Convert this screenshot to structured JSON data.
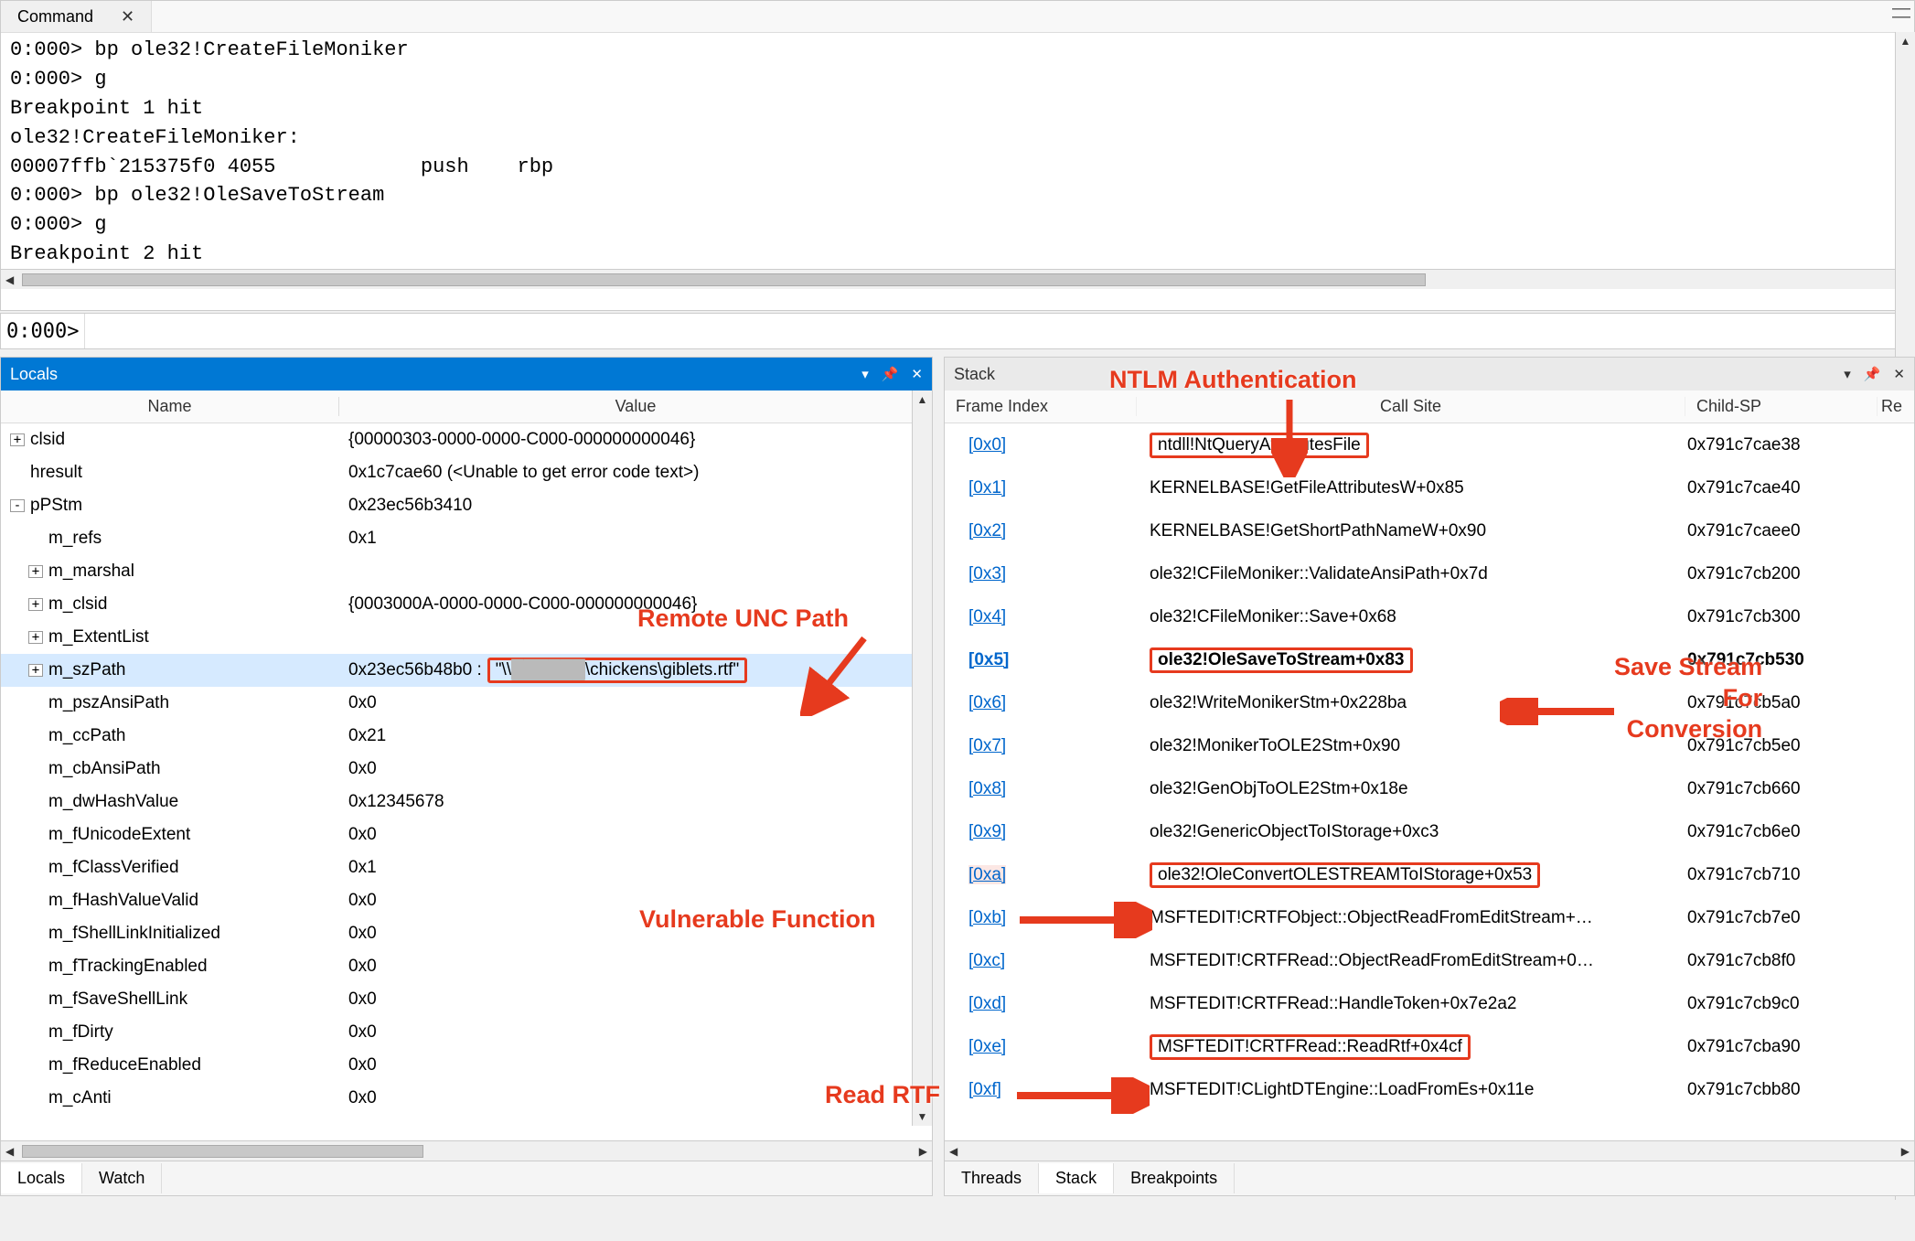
{
  "command": {
    "tab_title": "Command",
    "output_lines": [
      "0:000> bp ole32!CreateFileMoniker",
      "0:000> g",
      "Breakpoint 1 hit",
      "ole32!CreateFileMoniker:",
      "00007ffb`215375f0 4055            push    rbp",
      "0:000> bp ole32!OleSaveToStream",
      "0:000> g",
      "Breakpoint 2 hit"
    ],
    "prompt": "0:000>",
    "input": ""
  },
  "locals": {
    "title": "Locals",
    "header": {
      "name": "Name",
      "value": "Value"
    },
    "rows": [
      {
        "expand": "+",
        "indent": 0,
        "name": "clsid",
        "value": "{00000303-0000-0000-C000-000000000046}"
      },
      {
        "expand": "",
        "indent": 0,
        "name": "hresult",
        "value": "0x1c7cae60 (<Unable to get error code text>)"
      },
      {
        "expand": "-",
        "indent": 0,
        "name": "pPStm",
        "value": "0x23ec56b3410"
      },
      {
        "expand": "",
        "indent": 1,
        "name": "m_refs",
        "value": "0x1"
      },
      {
        "expand": "+",
        "indent": 1,
        "name": "m_marshal",
        "value": ""
      },
      {
        "expand": "+",
        "indent": 1,
        "name": "m_clsid",
        "value": "{0003000A-0000-0000-C000-000000000046}"
      },
      {
        "expand": "+",
        "indent": 1,
        "name": "m_ExtentList",
        "value": ""
      },
      {
        "expand": "+",
        "indent": 1,
        "name": "m_szPath",
        "value": "0x23ec56b48b0 :",
        "boxed": "\"\\\\▇▇▇▇▇▇▇\\chickens\\giblets.rtf\"",
        "selected": true
      },
      {
        "expand": "",
        "indent": 1,
        "name": "m_pszAnsiPath",
        "value": "0x0"
      },
      {
        "expand": "",
        "indent": 1,
        "name": "m_ccPath",
        "value": "0x21"
      },
      {
        "expand": "",
        "indent": 1,
        "name": "m_cbAnsiPath",
        "value": "0x0"
      },
      {
        "expand": "",
        "indent": 1,
        "name": "m_dwHashValue",
        "value": "0x12345678"
      },
      {
        "expand": "",
        "indent": 1,
        "name": "m_fUnicodeExtent",
        "value": "0x0"
      },
      {
        "expand": "",
        "indent": 1,
        "name": "m_fClassVerified",
        "value": "0x1"
      },
      {
        "expand": "",
        "indent": 1,
        "name": "m_fHashValueValid",
        "value": "0x0"
      },
      {
        "expand": "",
        "indent": 1,
        "name": "m_fShellLinkInitialized",
        "value": "0x0"
      },
      {
        "expand": "",
        "indent": 1,
        "name": "m_fTrackingEnabled",
        "value": "0x0"
      },
      {
        "expand": "",
        "indent": 1,
        "name": "m_fSaveShellLink",
        "value": "0x0"
      },
      {
        "expand": "",
        "indent": 1,
        "name": "m_fDirty",
        "value": "0x0"
      },
      {
        "expand": "",
        "indent": 1,
        "name": "m_fReduceEnabled",
        "value": "0x0"
      },
      {
        "expand": "",
        "indent": 1,
        "name": "m_cAnti",
        "value": "0x0"
      }
    ],
    "footer_tabs": [
      "Locals",
      "Watch"
    ],
    "footer_active": 0
  },
  "stack": {
    "title": "Stack",
    "header": {
      "idx": "Frame Index",
      "site": "Call Site",
      "child": "Child-SP",
      "ret": "Re"
    },
    "rows": [
      {
        "idx": "[0x0]",
        "site": "ntdll!NtQueryAttributesFile",
        "child": "0x791c7cae38",
        "boxed": true
      },
      {
        "idx": "[0x1]",
        "site": "KERNELBASE!GetFileAttributesW+0x85",
        "child": "0x791c7cae40"
      },
      {
        "idx": "[0x2]",
        "site": "KERNELBASE!GetShortPathNameW+0x90",
        "child": "0x791c7caee0"
      },
      {
        "idx": "[0x3]",
        "site": "ole32!CFileMoniker::ValidateAnsiPath+0x7d",
        "child": "0x791c7cb200"
      },
      {
        "idx": "[0x4]",
        "site": "ole32!CFileMoniker::Save+0x68",
        "child": "0x791c7cb300"
      },
      {
        "idx": "[0x5]",
        "site": "ole32!OleSaveToStream+0x83",
        "child": "0x791c7cb530",
        "boxed": true,
        "bold": true
      },
      {
        "idx": "[0x6]",
        "site": "ole32!WriteMonikerStm+0x228ba",
        "child": "0x791c7cb5a0"
      },
      {
        "idx": "[0x7]",
        "site": "ole32!MonikerToOLE2Stm+0x90",
        "child": "0x791c7cb5e0"
      },
      {
        "idx": "[0x8]",
        "site": "ole32!GenObjToOLE2Stm+0x18e",
        "child": "0x791c7cb660"
      },
      {
        "idx": "[0x9]",
        "site": "ole32!GenericObjectToIStorage+0xc3",
        "child": "0x791c7cb6e0"
      },
      {
        "idx": "[0xa]",
        "site": "ole32!OleConvertOLESTREAMToIStorage+0x53",
        "child": "0x791c7cb710",
        "boxed": true,
        "orangeidx": true
      },
      {
        "idx": "[0xb]",
        "site": "MSFTEDIT!CRTFObject::ObjectReadFromEditStream+…",
        "child": "0x791c7cb7e0"
      },
      {
        "idx": "[0xc]",
        "site": "MSFTEDIT!CRTFRead::ObjectReadFromEditStream+0…",
        "child": "0x791c7cb8f0"
      },
      {
        "idx": "[0xd]",
        "site": "MSFTEDIT!CRTFRead::HandleToken+0x7e2a2",
        "child": "0x791c7cb9c0"
      },
      {
        "idx": "[0xe]",
        "site": "MSFTEDIT!CRTFRead::ReadRtf+0x4cf",
        "child": "0x791c7cba90",
        "boxed": true
      },
      {
        "idx": "[0xf]",
        "site": "MSFTEDIT!CLightDTEngine::LoadFromEs+0x11e",
        "child": "0x791c7cbb80"
      }
    ],
    "footer_tabs": [
      "Threads",
      "Stack",
      "Breakpoints"
    ],
    "footer_active": 1
  },
  "annotations": {
    "ntlm": "NTLM Authentication",
    "unc": "Remote UNC Path",
    "save": "Save Stream For Conversion",
    "vuln": "Vulnerable Function",
    "read": "Read RTF"
  }
}
